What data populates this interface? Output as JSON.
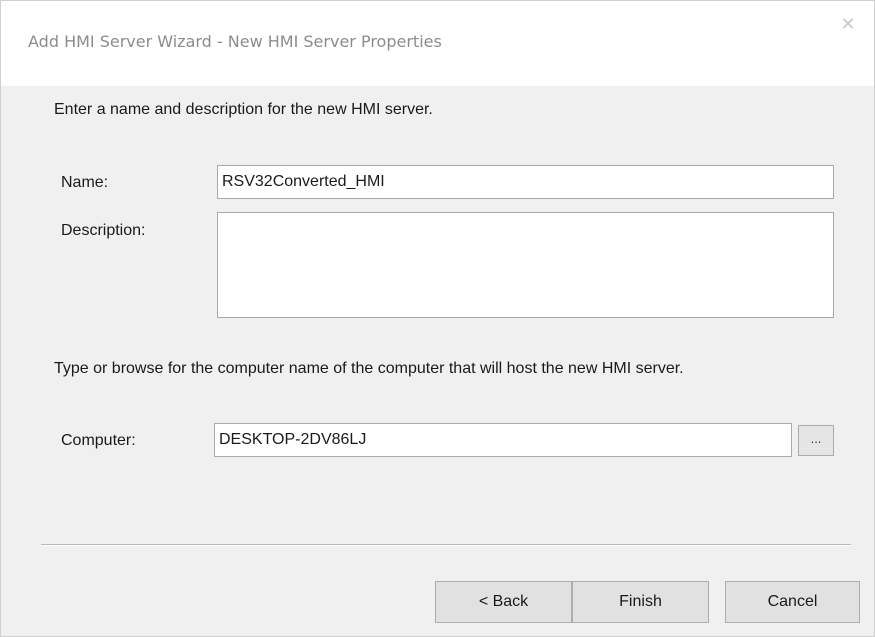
{
  "window": {
    "title": "Add HMI Server Wizard - New HMI Server Properties",
    "close_glyph": "✕"
  },
  "form": {
    "instructions": "Enter a name and description for the new HMI server.",
    "name_label": "Name:",
    "name_value": "RSV32Converted_HMI",
    "description_label": "Description:",
    "description_value": "",
    "computer_instructions": "Type or browse for the computer name of the computer that will host the new HMI server.",
    "computer_label": "Computer:",
    "computer_value": "DESKTOP-2DV86LJ",
    "browse_label": "..."
  },
  "buttons": {
    "back": "< Back",
    "finish": "Finish",
    "cancel": "Cancel"
  }
}
